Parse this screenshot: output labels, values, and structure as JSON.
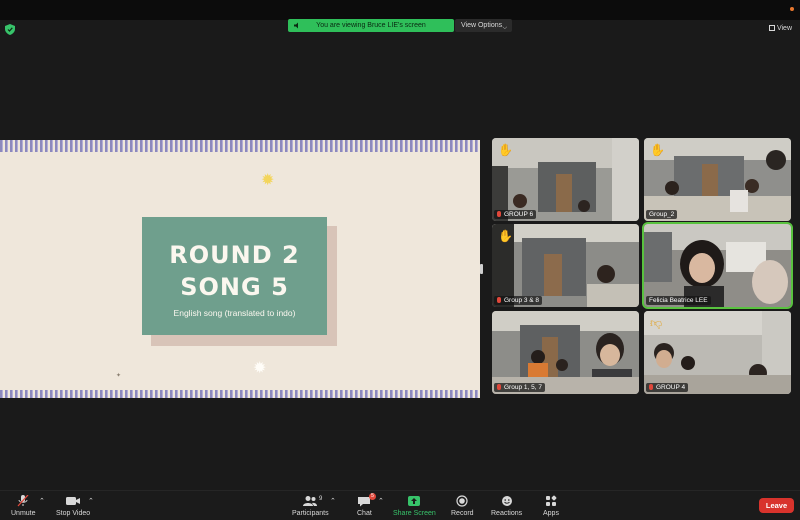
{
  "banner": {
    "text": "You are viewing Bruce LIE's screen",
    "view_options_label": "View Options"
  },
  "view_button": {
    "label": "View"
  },
  "slide": {
    "title_line1": "ROUND 2",
    "title_line2": "SONG 5",
    "subtitle": "English song (translated to indo)"
  },
  "participants": [
    {
      "name": "GROUP 6",
      "hand_raised": true,
      "muted": true
    },
    {
      "name": "Group_2",
      "hand_raised": true,
      "muted": false
    },
    {
      "name": "Group 3 & 8",
      "hand_raised": true,
      "muted": true
    },
    {
      "name": "Felicia Beatrice LEE",
      "hand_raised": false,
      "muted": false,
      "active_speaker": true
    },
    {
      "name": "Group 1, 5, 7",
      "hand_raised": false,
      "muted": true
    },
    {
      "name": "GROUP 4",
      "hand_raised": false,
      "muted": true,
      "reaction": "thumbs-down"
    }
  ],
  "toolbar": {
    "unmute": "Unmute",
    "stop_video": "Stop Video",
    "participants": "Participants",
    "participants_count": "9",
    "chat": "Chat",
    "chat_badge": "5",
    "share_screen": "Share Screen",
    "record": "Record",
    "reactions": "Reactions",
    "apps": "Apps",
    "leave": "Leave"
  },
  "colors": {
    "share_green": "#2fbf5a",
    "active_speaker_outline": "#59c23f",
    "leave_red": "#d8332c",
    "slide_card": "#6f9f8d",
    "slide_background": "#efe7db"
  }
}
